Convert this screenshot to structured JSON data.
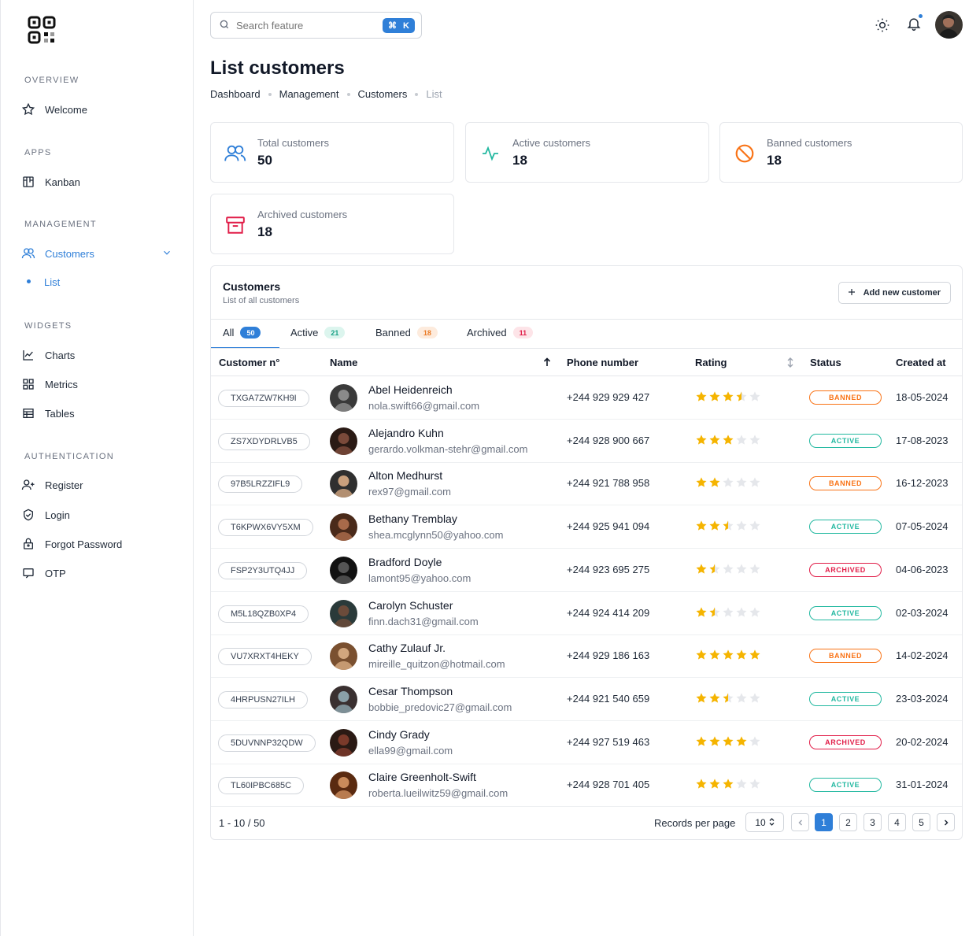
{
  "sidebar": {
    "sections": {
      "overview": "OVERVIEW",
      "apps": "APPS",
      "management": "MANAGEMENT",
      "widgets": "WIDGETS",
      "authentication": "AUTHENTICATION"
    },
    "items": {
      "welcome": "Welcome",
      "kanban": "Kanban",
      "customers": "Customers",
      "list": "List",
      "charts": "Charts",
      "metrics": "Metrics",
      "tables": "Tables",
      "register": "Register",
      "login": "Login",
      "forgot": "Forgot Password",
      "otp": "OTP"
    }
  },
  "search": {
    "placeholder": "Search feature",
    "shortcut_key": "K"
  },
  "page": {
    "title": "List customers"
  },
  "breadcrumb": [
    "Dashboard",
    "Management",
    "Customers",
    "List"
  ],
  "stats": {
    "total": {
      "label": "Total customers",
      "value": "50"
    },
    "active": {
      "label": "Active customers",
      "value": "18"
    },
    "banned": {
      "label": "Banned customers",
      "value": "18"
    },
    "archived": {
      "label": "Archived customers",
      "value": "18"
    }
  },
  "panel": {
    "title": "Customers",
    "subtitle": "List of all customers",
    "add_button": "Add new customer"
  },
  "tabs": [
    {
      "label": "All",
      "count": "50"
    },
    {
      "label": "Active",
      "count": "21"
    },
    {
      "label": "Banned",
      "count": "18"
    },
    {
      "label": "Archived",
      "count": "11"
    }
  ],
  "columns": {
    "customer_no": "Customer n°",
    "name": "Name",
    "phone": "Phone number",
    "rating": "Rating",
    "status": "Status",
    "created": "Created at"
  },
  "rows": [
    {
      "id": "TXGA7ZW7KH9I",
      "name": "Abel Heidenreich",
      "email": "nola.swift66@gmail.com",
      "phone": "+244 929 929 427",
      "rating": 3.5,
      "status": "BANNED",
      "created": "18-05-2024"
    },
    {
      "id": "ZS7XDYDRLVB5",
      "name": "Alejandro Kuhn",
      "email": "gerardo.volkman-stehr@gmail.com",
      "phone": "+244 928 900 667",
      "rating": 3,
      "status": "ACTIVE",
      "created": "17-08-2023"
    },
    {
      "id": "97B5LRZZIFL9",
      "name": "Alton Medhurst",
      "email": "rex97@gmail.com",
      "phone": "+244 921 788 958",
      "rating": 2,
      "status": "BANNED",
      "created": "16-12-2023"
    },
    {
      "id": "T6KPWX6VY5XM",
      "name": "Bethany Tremblay",
      "email": "shea.mcglynn50@yahoo.com",
      "phone": "+244 925 941 094",
      "rating": 2.5,
      "status": "ACTIVE",
      "created": "07-05-2024"
    },
    {
      "id": "FSP2Y3UTQ4JJ",
      "name": "Bradford Doyle",
      "email": "lamont95@yahoo.com",
      "phone": "+244 923 695 275",
      "rating": 1.5,
      "status": "ARCHIVED",
      "created": "04-06-2023"
    },
    {
      "id": "M5L18QZB0XP4",
      "name": "Carolyn Schuster",
      "email": "finn.dach31@gmail.com",
      "phone": "+244 924 414 209",
      "rating": 1.5,
      "status": "ACTIVE",
      "created": "02-03-2024"
    },
    {
      "id": "VU7XRXT4HEKY",
      "name": "Cathy Zulauf Jr.",
      "email": "mireille_quitzon@hotmail.com",
      "phone": "+244 929 186 163",
      "rating": 5,
      "status": "BANNED",
      "created": "14-02-2024"
    },
    {
      "id": "4HRPUSN27ILH",
      "name": "Cesar Thompson",
      "email": "bobbie_predovic27@gmail.com",
      "phone": "+244 921 540 659",
      "rating": 2.5,
      "status": "ACTIVE",
      "created": "23-03-2024"
    },
    {
      "id": "5DUVNNP32QDW",
      "name": "Cindy Grady",
      "email": "ella99@gmail.com",
      "phone": "+244 927 519 463",
      "rating": 4,
      "status": "ARCHIVED",
      "created": "20-02-2024"
    },
    {
      "id": "TL60IPBC685C",
      "name": "Claire Greenholt-Swift",
      "email": "roberta.lueilwitz59@gmail.com",
      "phone": "+244 928 701 405",
      "rating": 3,
      "status": "ACTIVE",
      "created": "31-01-2024"
    }
  ],
  "footer": {
    "range": "1 - 10 / 50",
    "records_label": "Records per page",
    "per_page": "10",
    "pages": [
      "1",
      "2",
      "3",
      "4",
      "5"
    ],
    "current_page": "1"
  },
  "colors": {
    "accent": "#2f7fd8",
    "star": "#f5b400",
    "banned": "#f97316",
    "active": "#22b8a0",
    "archived": "#e11d48"
  }
}
